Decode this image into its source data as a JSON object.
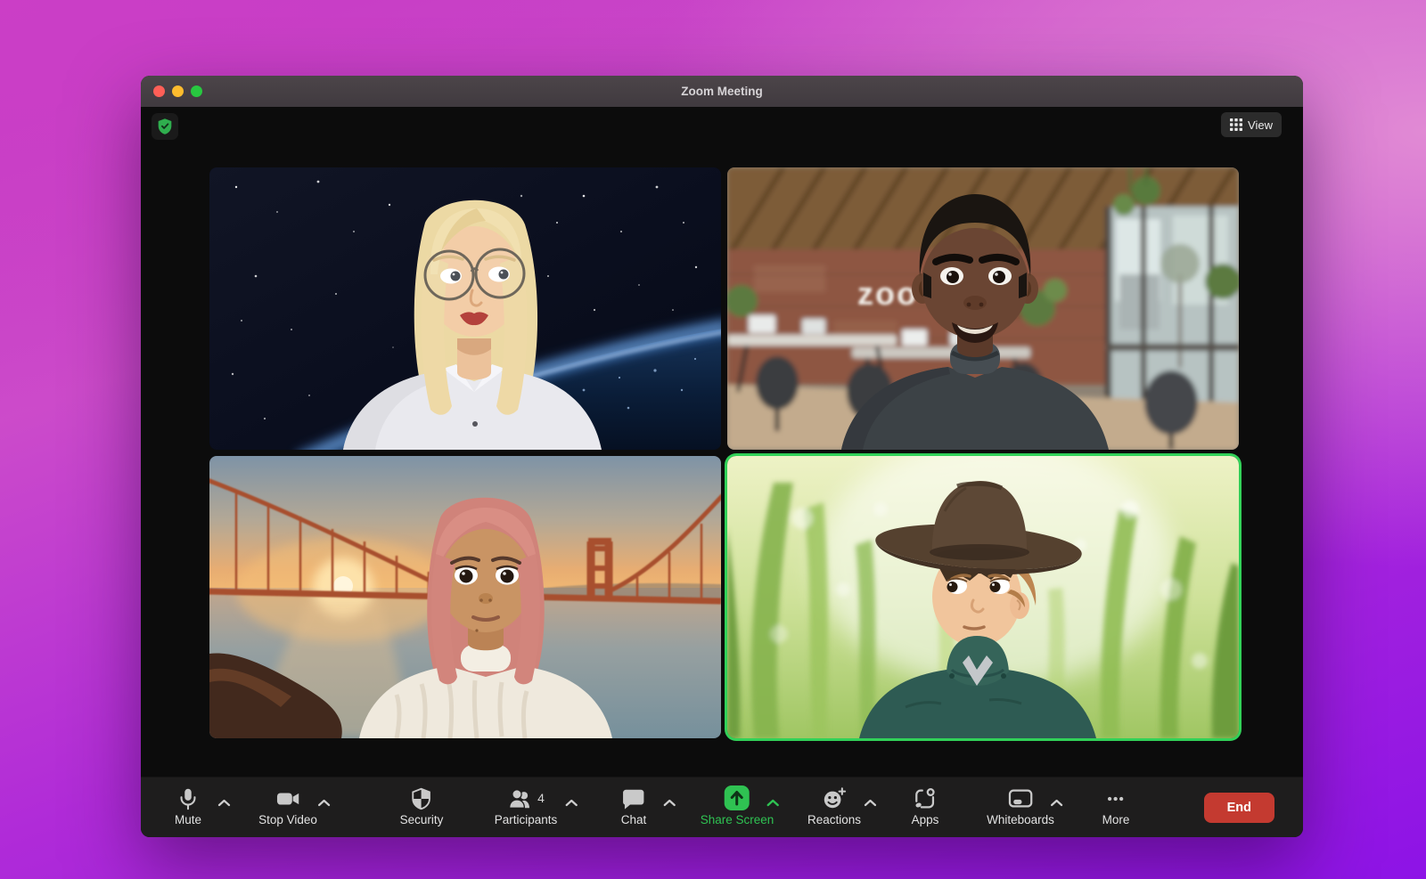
{
  "window": {
    "title": "Zoom Meeting"
  },
  "meeting": {
    "view_button_label": "View",
    "security_badge": "meeting-encrypted-shield",
    "participants": [
      {
        "id": 1,
        "avatar": "blonde-woman-with-glasses",
        "background": "earth-from-space",
        "active": false
      },
      {
        "id": 2,
        "avatar": "man-short-dark-hair-charcoal-sweater",
        "background": "open-office-with-zoom-logo",
        "active": false
      },
      {
        "id": 3,
        "avatar": "pink-hair-woman-white-sweater",
        "background": "golden-gate-bridge-sunset",
        "active": false
      },
      {
        "id": 4,
        "avatar": "boy-with-brown-hat-teal-hoodie",
        "background": "green-grass-closeup",
        "active": true
      }
    ]
  },
  "toolbar": {
    "items": [
      {
        "label": "Mute",
        "icon": "microphone-icon",
        "chevron": true
      },
      {
        "label": "Stop Video",
        "icon": "video-camera-icon",
        "chevron": true
      },
      {
        "label": "Security",
        "icon": "security-shield-icon",
        "chevron": false
      },
      {
        "label": "Participants",
        "icon": "participants-icon",
        "chevron": true,
        "badge": "4"
      },
      {
        "label": "Chat",
        "icon": "chat-bubble-icon",
        "chevron": true
      },
      {
        "label": "Share Screen",
        "icon": "share-screen-icon",
        "chevron": true,
        "active": true
      },
      {
        "label": "Reactions",
        "icon": "reactions-smiley-icon",
        "chevron": true
      },
      {
        "label": "Apps",
        "icon": "apps-icon",
        "chevron": false
      },
      {
        "label": "Whiteboards",
        "icon": "whiteboard-icon",
        "chevron": true
      },
      {
        "label": "More",
        "icon": "more-ellipsis-icon",
        "chevron": false
      }
    ],
    "end_button_label": "End"
  },
  "colors": {
    "accent_green": "#2fc252",
    "end_red": "#c43a30",
    "active_speaker_border": "#31d158",
    "traffic_red": "#ff5f57",
    "traffic_yellow": "#febc2e",
    "traffic_green": "#28c840"
  }
}
